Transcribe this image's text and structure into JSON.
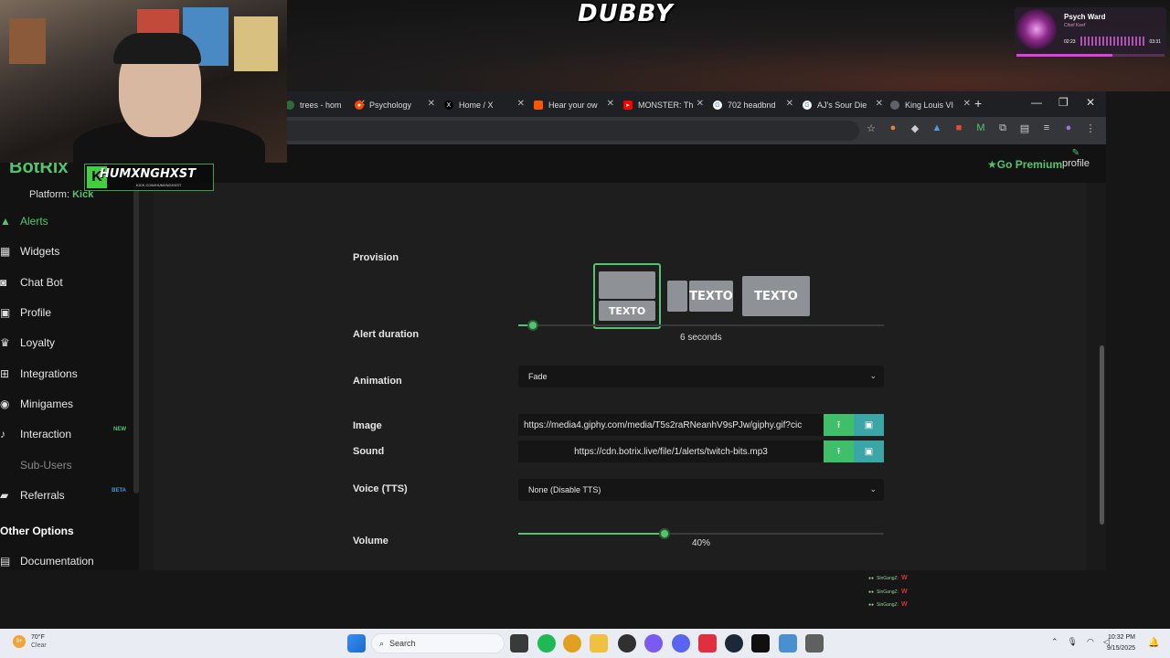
{
  "stream": {
    "logo": "DUBBY",
    "now_playing": {
      "title": "Psych Ward",
      "artist": "Chief Keef",
      "elapsed": "02:23",
      "total": "03:31",
      "progress": 0.65
    },
    "handle": {
      "name": "HUMXNGHXST",
      "url": "KICK.COM/HUMXNGHXST"
    },
    "chat": [
      {
        "user": "SinGangZ:",
        "msg": "W"
      },
      {
        "user": "SinGangZ:",
        "msg": "W"
      },
      {
        "user": "SinGangZ:",
        "msg": "W"
      }
    ]
  },
  "browser": {
    "tabs": [
      {
        "label": "trees - hom",
        "icon": "tree-icon",
        "color": "#2d6b3a"
      },
      {
        "label": "Psychology",
        "icon": "reddit-icon",
        "color": "#ff4500"
      },
      {
        "label": "Home / X",
        "icon": "x-icon",
        "color": "#000000"
      },
      {
        "label": "Hear your ow",
        "icon": "soundcloud-icon",
        "color": "#ff5500"
      },
      {
        "label": "MONSTER: Th",
        "icon": "youtube-icon",
        "color": "#ff0000"
      },
      {
        "label": "702 headbnd",
        "icon": "google-icon",
        "color": "#4285f4"
      },
      {
        "label": "AJ's Sour Die",
        "icon": "google-icon",
        "color": "#4285f4"
      },
      {
        "label": "King Louis VI",
        "icon": "globe-icon",
        "color": "#5f6368"
      }
    ]
  },
  "app": {
    "brand": "BotRix",
    "go_premium": "Go Premium",
    "profile": "profile",
    "platform_label": "Platform:",
    "platform_value": "Kick",
    "sidebar": [
      {
        "label": "Alerts",
        "icon": "warning-icon",
        "state": "active",
        "badge": ""
      },
      {
        "label": "Widgets",
        "icon": "widgets-icon",
        "state": "normal",
        "badge": ""
      },
      {
        "label": "Chat Bot",
        "icon": "robot-icon",
        "state": "normal",
        "badge": ""
      },
      {
        "label": "Profile",
        "icon": "id-card-icon",
        "state": "normal",
        "badge": ""
      },
      {
        "label": "Loyalty",
        "icon": "trophy-icon",
        "state": "normal",
        "badge": ""
      },
      {
        "label": "Integrations",
        "icon": "integrations-icon",
        "state": "normal",
        "badge": ""
      },
      {
        "label": "Minigames",
        "icon": "gamepad-icon",
        "state": "normal",
        "badge": ""
      },
      {
        "label": "Interaction",
        "icon": "music-icon",
        "state": "normal",
        "badge": "NEW"
      },
      {
        "label": "Sub-Users",
        "icon": "users-icon",
        "state": "disabled",
        "badge": ""
      },
      {
        "label": "Referrals",
        "icon": "referrals-icon",
        "state": "normal",
        "badge": "BETA"
      }
    ],
    "other_options": "Other Options",
    "documentation": "Documentation",
    "form": {
      "provision_label": "Provision",
      "provision_text": "TEXTO",
      "provision_selected": 0,
      "duration_label": "Alert duration",
      "duration_value": "6 seconds",
      "duration_fraction": 0.04,
      "animation_label": "Animation",
      "animation_value": "Fade",
      "image_label": "Image",
      "image_value": "https://media4.giphy.com/media/T5s2raRNeanhV9sPJw/giphy.gif?cic",
      "sound_label": "Sound",
      "sound_value": "https://cdn.botrix.live/file/1/alerts/twitch-bits.mp3",
      "voice_label": "Voice (TTS)",
      "voice_value": "None (Disable TTS)",
      "volume_label": "Volume",
      "volume_value": "40%",
      "volume_fraction": 0.4
    }
  },
  "taskbar": {
    "weather_temp": "70°F",
    "weather_desc": "Clear",
    "weather_badge": "9+",
    "search_placeholder": "Search",
    "time": "10:32 PM",
    "date": "9/15/2025"
  }
}
